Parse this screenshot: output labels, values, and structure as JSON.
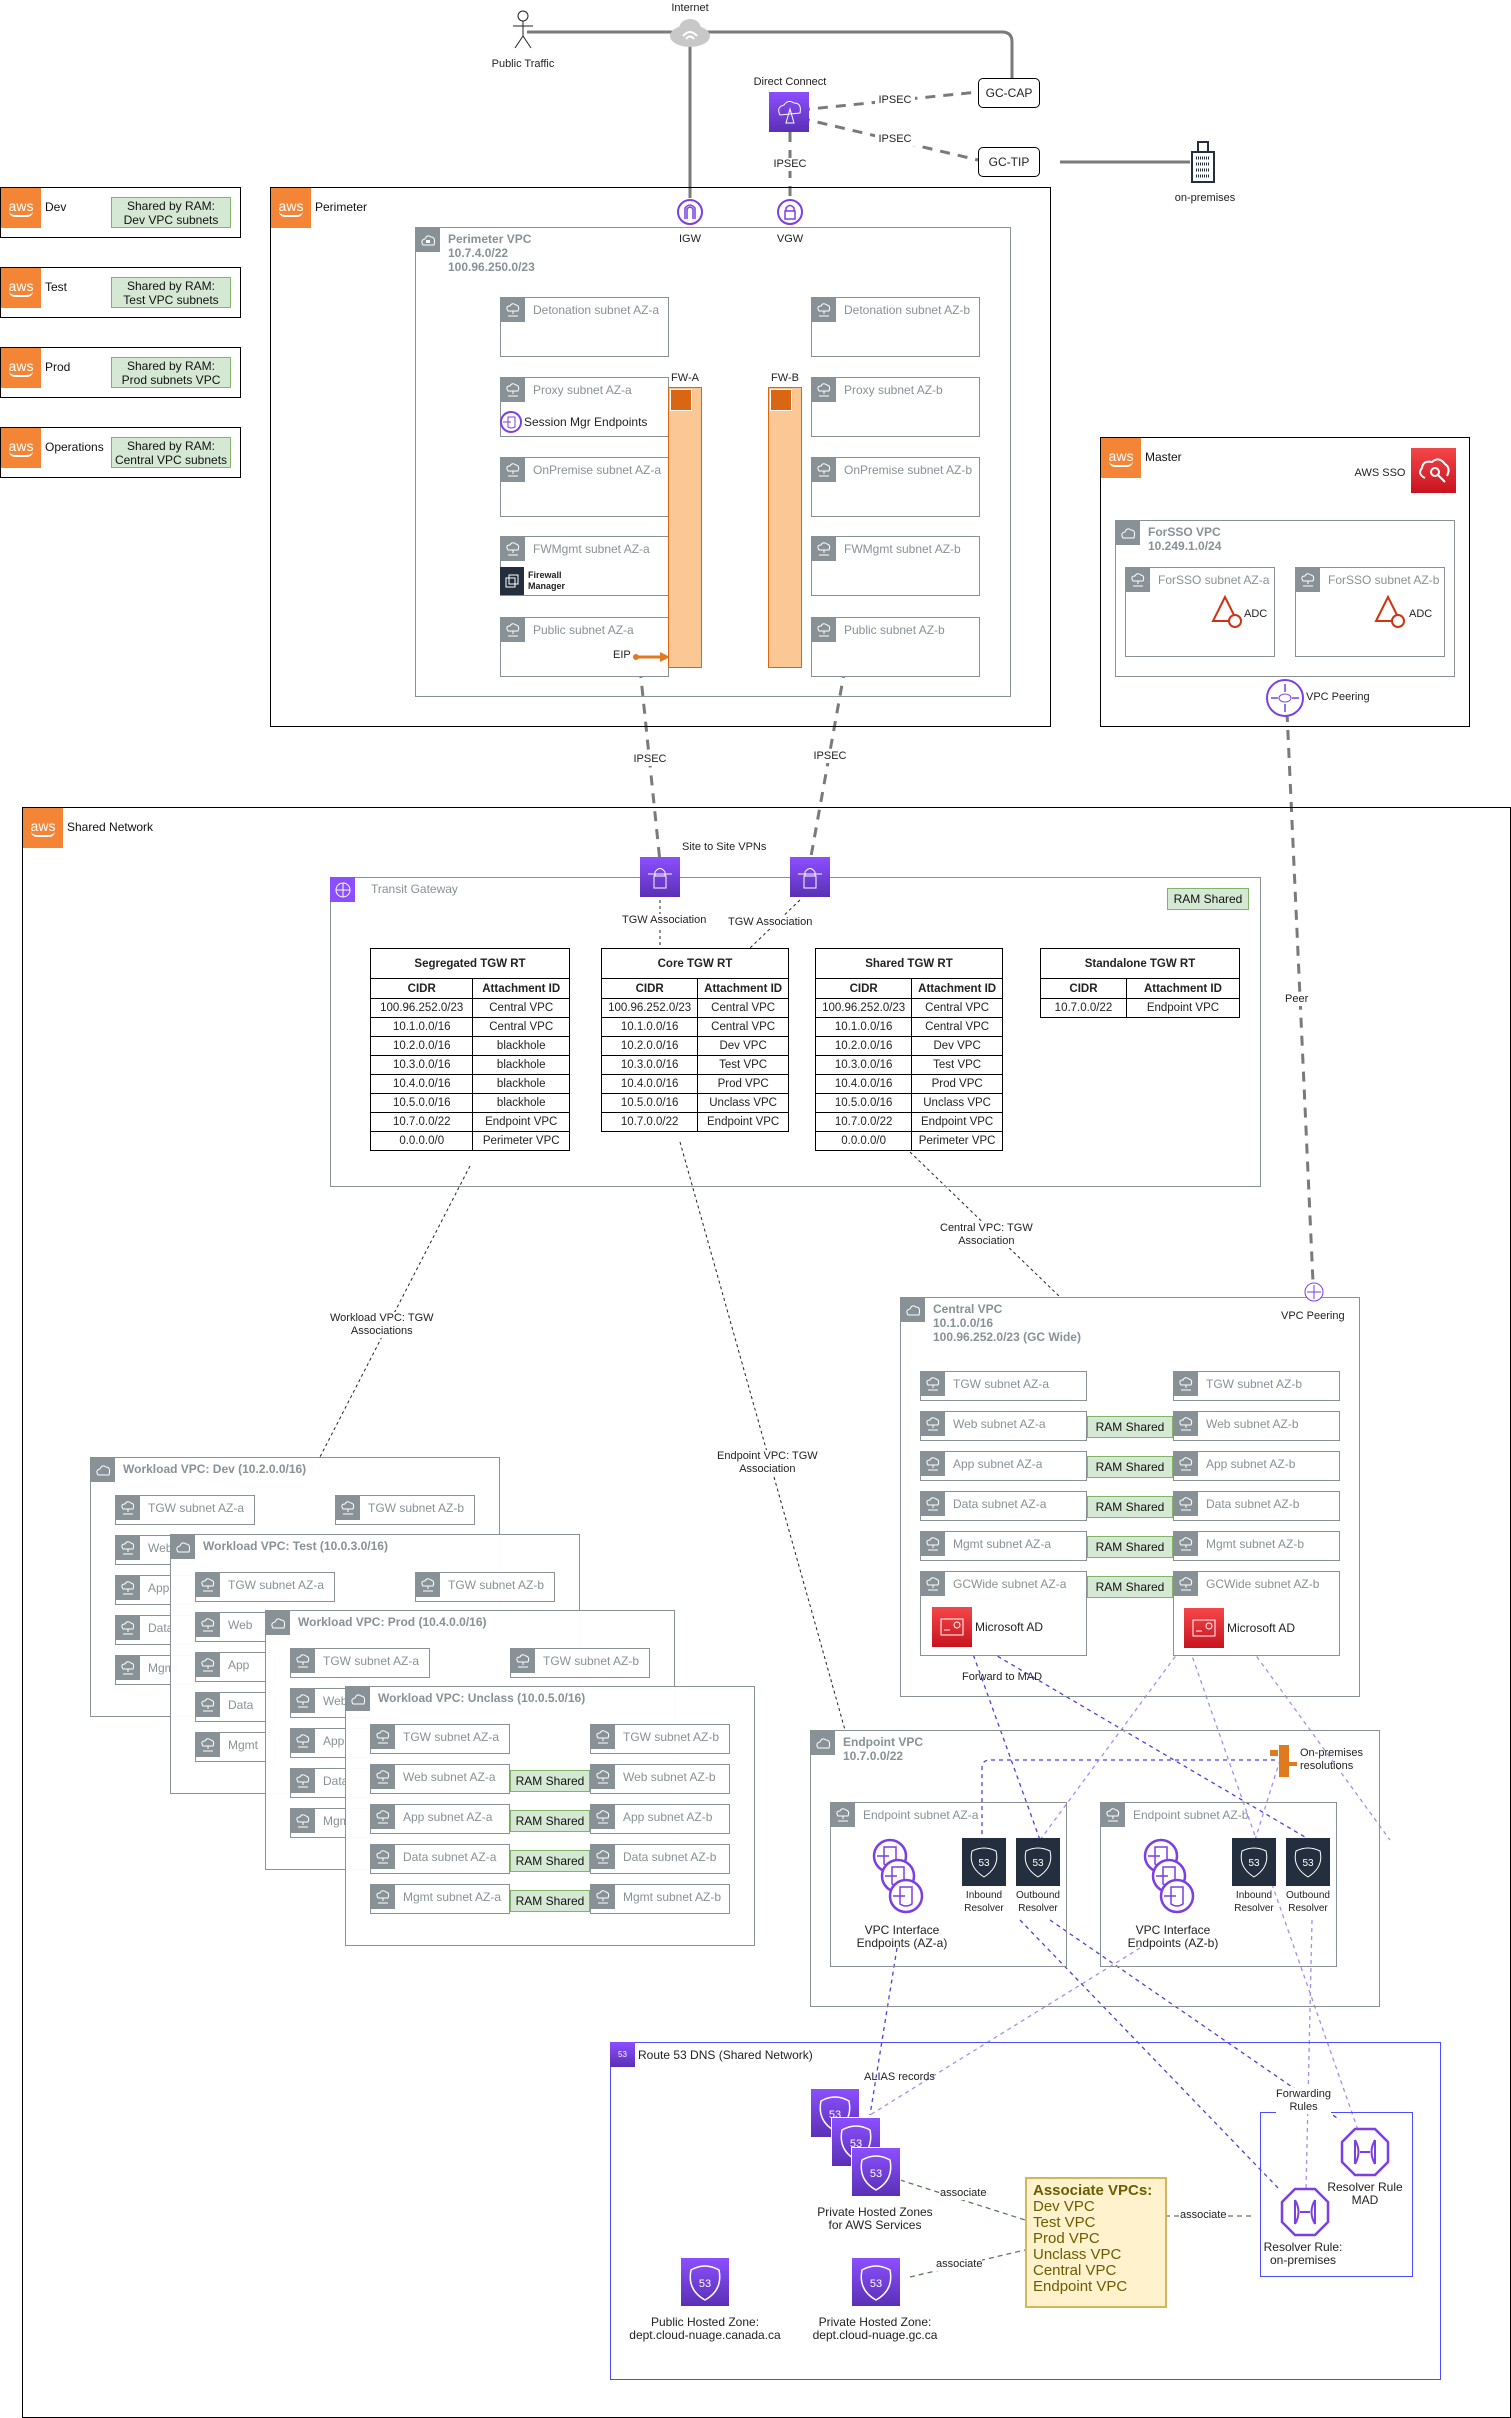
{
  "external": {
    "internet": "Internet",
    "public_traffic": "Public Traffic",
    "direct_connect": "Direct Connect",
    "gc_cap": "GC-CAP",
    "gc_tip": "GC-TIP",
    "on_premises": "on-premises",
    "ipsec": "IPSEC"
  },
  "accounts": [
    {
      "name": "Dev",
      "ram_note": "Shared by RAM:\nDev VPC subnets"
    },
    {
      "name": "Test",
      "ram_note": "Shared by RAM:\nTest VPC subnets"
    },
    {
      "name": "Prod",
      "ram_note": "Shared by RAM:\nProd subnets VPC"
    },
    {
      "name": "Operations",
      "ram_note": "Shared by RAM:\nCentral VPC subnets"
    }
  ],
  "perimeter": {
    "account": "Perimeter",
    "vpc_title": "Perimeter VPC\n10.7.4.0/22\n100.96.250.0/23",
    "igw": "IGW",
    "vgw": "VGW",
    "fw_a": "FW-A",
    "fw_b": "FW-B",
    "eip": "EIP",
    "session_mgr": "Session Mgr Endpoints",
    "firewall_manager": "Firewall\nManager",
    "subnets_a": [
      "Detonation subnet AZ-a",
      "Proxy subnet AZ-a",
      "OnPremise subnet AZ-a",
      "FWMgmt subnet AZ-a",
      "Public subnet AZ-a"
    ],
    "subnets_b": [
      "Detonation subnet AZ-b",
      "Proxy subnet AZ-b",
      "OnPremise subnet AZ-b",
      "FWMgmt subnet AZ-b",
      "Public subnet AZ-b"
    ]
  },
  "master": {
    "account": "Master",
    "aws_sso": "AWS SSO",
    "vpc_title": "ForSSO VPC\n10.249.1.0/24",
    "subnet_a": "ForSSO subnet AZ-a",
    "subnet_b": "ForSSO subnet AZ-b",
    "adc": "ADC",
    "vpc_peering": "VPC Peering"
  },
  "shared_network": {
    "account": "Shared Network",
    "site_to_site": "Site to Site VPNs",
    "tgw_title": "Transit Gateway",
    "ram_shared": "RAM Shared",
    "tgw_association": "TGW Association",
    "peer": "Peer",
    "workload_assoc": "Workload VPC: TGW\nAssociations",
    "endpoint_assoc": "Endpoint VPC: TGW\nAssociation",
    "central_assoc": "Central VPC: TGW\nAssociation",
    "route_tables": [
      {
        "title": "Segregated TGW RT",
        "headers": [
          "CIDR",
          "Attachment ID"
        ],
        "rows": [
          [
            "100.96.252.0/23",
            "Central VPC"
          ],
          [
            "10.1.0.0/16",
            "Central VPC"
          ],
          [
            "10.2.0.0/16",
            "blackhole"
          ],
          [
            "10.3.0.0/16",
            "blackhole"
          ],
          [
            "10.4.0.0/16",
            "blackhole"
          ],
          [
            "10.5.0.0/16",
            "blackhole"
          ],
          [
            "10.7.0.0/22",
            "Endpoint VPC"
          ],
          [
            "0.0.0.0/0",
            "Perimeter VPC"
          ]
        ]
      },
      {
        "title": "Core TGW RT",
        "headers": [
          "CIDR",
          "Attachment ID"
        ],
        "rows": [
          [
            "100.96.252.0/23",
            "Central VPC"
          ],
          [
            "10.1.0.0/16",
            "Central VPC"
          ],
          [
            "10.2.0.0/16",
            "Dev VPC"
          ],
          [
            "10.3.0.0/16",
            "Test VPC"
          ],
          [
            "10.4.0.0/16",
            "Prod VPC"
          ],
          [
            "10.5.0.0/16",
            "Unclass VPC"
          ],
          [
            "10.7.0.0/22",
            "Endpoint VPC"
          ]
        ]
      },
      {
        "title": "Shared TGW RT",
        "headers": [
          "CIDR",
          "Attachment ID"
        ],
        "rows": [
          [
            "100.96.252.0/23",
            "Central VPC"
          ],
          [
            "10.1.0.0/16",
            "Central VPC"
          ],
          [
            "10.2.0.0/16",
            "Dev VPC"
          ],
          [
            "10.3.0.0/16",
            "Test VPC"
          ],
          [
            "10.4.0.0/16",
            "Prod VPC"
          ],
          [
            "10.5.0.0/16",
            "Unclass VPC"
          ],
          [
            "10.7.0.0/22",
            "Endpoint VPC"
          ],
          [
            "0.0.0.0/0",
            "Perimeter VPC"
          ]
        ]
      },
      {
        "title": "Standalone TGW RT",
        "headers": [
          "CIDR",
          "Attachment ID"
        ],
        "rows": [
          [
            "10.7.0.0/22",
            "Endpoint VPC"
          ]
        ]
      }
    ],
    "central_vpc": {
      "title": "Central VPC\n10.1.0.0/16\n100.96.252.0/23 (GC Wide)",
      "vpc_peering": "VPC Peering",
      "subnets_a": [
        "TGW subnet AZ-a",
        "Web subnet AZ-a",
        "App subnet AZ-a",
        "Data subnet AZ-a",
        "Mgmt subnet AZ-a",
        "GCWide subnet AZ-a"
      ],
      "subnets_b": [
        "TGW subnet AZ-b",
        "Web subnet AZ-b",
        "App subnet AZ-b",
        "Data subnet AZ-b",
        "Mgmt subnet AZ-b",
        "GCWide subnet AZ-b"
      ],
      "microsoft_ad": "Microsoft AD",
      "forward_to_mad": "Forward to MAD"
    },
    "workload_vpcs": [
      {
        "title": "Workload VPC: Dev (10.2.0.0/16)"
      },
      {
        "title": "Workload VPC: Test (10.0.3.0/16)"
      },
      {
        "title": "Workload VPC: Prod (10.4.0.0/16)"
      },
      {
        "title": "Workload VPC: Unclass (10.0.5.0/16)"
      }
    ],
    "workload_subnets_a": [
      "TGW subnet AZ-a",
      "Web subnet AZ-a",
      "App subnet AZ-a",
      "Data subnet AZ-a",
      "Mgmt subnet AZ-a"
    ],
    "workload_subnets_b": [
      "TGW subnet AZ-b",
      "Web subnet AZ-b",
      "App subnet AZ-b",
      "Data subnet AZ-b",
      "Mgmt subnet AZ-b"
    ],
    "workload_partial": [
      "Web",
      "App",
      "Data",
      "Mgmt"
    ],
    "endpoint_vpc": {
      "title": "Endpoint VPC\n10.7.0.0/22",
      "on_prem_res": "On-premises\nresolutions",
      "subnet_a": "Endpoint subnet AZ-a",
      "subnet_b": "Endpoint subnet AZ-b",
      "inbound": "Inbound\nResolver",
      "outbound": "Outbound\nResolver",
      "vpce_a": "VPC Interface\nEndpoints (AZ-a)",
      "vpce_b": "VPC Interface\nEndpoints (AZ-b)"
    },
    "route53": {
      "title": "Route 53 DNS (Shared Network)",
      "alias_records": "ALIAS records",
      "phz_aws": "Private Hosted Zones\nfor AWS Services",
      "public_zone": "Public Hosted Zone:\ndept.cloud-nuage.canada.ca",
      "private_zone": "Private Hosted Zone:\ndept.cloud-nuage.gc.ca",
      "associate": "associate",
      "note_title": "Associate VPCs:",
      "note_items": [
        "Dev VPC",
        "Test VPC",
        "Prod VPC",
        "Unclass VPC",
        "Central VPC",
        "Endpoint VPC"
      ],
      "forwarding_rules": "Forwarding\nRules",
      "rule_mad": "Resolver Rule\nMAD",
      "rule_onprem": "Resolver Rule:\non-premises"
    }
  }
}
